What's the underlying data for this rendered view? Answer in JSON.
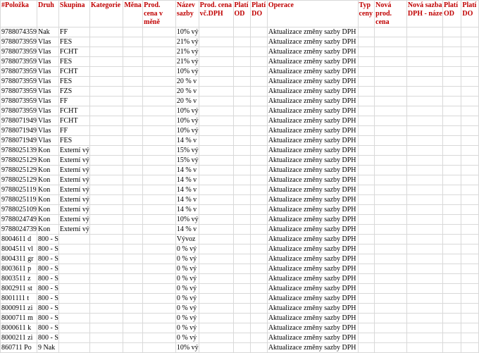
{
  "headers": [
    "#Položka",
    "Druh",
    "Skupina",
    "Kategorie",
    "Měna",
    "Prod. cena v měně",
    "Název sazby",
    "Prod. cena vč.DPH",
    "Platí OD",
    "Platí DO",
    "Operace",
    "Typ ceny",
    "Nová prod. cena",
    "Nová sazba DPH - náze",
    "Platí OD",
    "Platí DO"
  ],
  "rows": [
    [
      "9788074359",
      "Nak",
      "FF",
      "",
      "",
      "",
      "10% vý",
      "",
      "",
      "",
      "Aktualizace změny sazby DPH",
      "",
      "",
      "",
      "",
      ""
    ],
    [
      "9788073959",
      "Vlas",
      "FES",
      "",
      "",
      "",
      "21% vý",
      "",
      "",
      "",
      "Aktualizace změny sazby DPH",
      "",
      "",
      "",
      "",
      ""
    ],
    [
      "9788073959",
      "Vlas",
      "FCHT",
      "",
      "",
      "",
      "21% vý",
      "",
      "",
      "",
      "Aktualizace změny sazby DPH",
      "",
      "",
      "",
      "",
      ""
    ],
    [
      "9788073959",
      "Vlas",
      "FES",
      "",
      "",
      "",
      "21% vý",
      "",
      "",
      "",
      "Aktualizace změny sazby DPH",
      "",
      "",
      "",
      "",
      ""
    ],
    [
      "9788073959",
      "Vlas",
      "FCHT",
      "",
      "",
      "",
      "10% vý",
      "",
      "",
      "",
      "Aktualizace změny sazby DPH",
      "",
      "",
      "",
      "",
      ""
    ],
    [
      "9788073959",
      "Vlas",
      "FES",
      "",
      "",
      "",
      "20 % v",
      "",
      "",
      "",
      "Aktualizace změny sazby DPH",
      "",
      "",
      "",
      "",
      ""
    ],
    [
      "9788073959",
      "Vlas",
      "FZS",
      "",
      "",
      "",
      "20 % v",
      "",
      "",
      "",
      "Aktualizace změny sazby DPH",
      "",
      "",
      "",
      "",
      ""
    ],
    [
      "9788073959",
      "Vlas",
      "FF",
      "",
      "",
      "",
      "20 % v",
      "",
      "",
      "",
      "Aktualizace změny sazby DPH",
      "",
      "",
      "",
      "",
      ""
    ],
    [
      "9788073959",
      "Vlas",
      "FCHT",
      "",
      "",
      "",
      "10% vý",
      "",
      "",
      "",
      "Aktualizace změny sazby DPH",
      "",
      "",
      "",
      "",
      ""
    ],
    [
      "9788071949",
      "Vlas",
      "FCHT",
      "",
      "",
      "",
      "10% vý",
      "",
      "",
      "",
      "Aktualizace změny sazby DPH",
      "",
      "",
      "",
      "",
      ""
    ],
    [
      "9788071949",
      "Vlas",
      "FF",
      "",
      "",
      "",
      "10% vý",
      "",
      "",
      "",
      "Aktualizace změny sazby DPH",
      "",
      "",
      "",
      "",
      ""
    ],
    [
      "9788071949",
      "Vlas",
      "FES",
      "",
      "",
      "",
      "14 % v",
      "",
      "",
      "",
      "Aktualizace změny sazby DPH",
      "",
      "",
      "",
      "",
      ""
    ],
    [
      "9788025139",
      "Kon",
      "Externí vý",
      "",
      "",
      "",
      "15% vý",
      "",
      "",
      "",
      "Aktualizace změny sazby DPH",
      "",
      "",
      "",
      "",
      ""
    ],
    [
      "9788025129",
      "Kon",
      "Externí vý",
      "",
      "",
      "",
      "15% vý",
      "",
      "",
      "",
      "Aktualizace změny sazby DPH",
      "",
      "",
      "",
      "",
      ""
    ],
    [
      "9788025129",
      "Kon",
      "Externí vý",
      "",
      "",
      "",
      "14 % v",
      "",
      "",
      "",
      "Aktualizace změny sazby DPH",
      "",
      "",
      "",
      "",
      ""
    ],
    [
      "9788025129",
      "Kon",
      "Externí vý",
      "",
      "",
      "",
      "14 % v",
      "",
      "",
      "",
      "Aktualizace změny sazby DPH",
      "",
      "",
      "",
      "",
      ""
    ],
    [
      "9788025119",
      "Kon",
      "Externí vý",
      "",
      "",
      "",
      "14 % v",
      "",
      "",
      "",
      "Aktualizace změny sazby DPH",
      "",
      "",
      "",
      "",
      ""
    ],
    [
      "9788025119",
      "Kon",
      "Externí vý",
      "",
      "",
      "",
      "14 % v",
      "",
      "",
      "",
      "Aktualizace změny sazby DPH",
      "",
      "",
      "",
      "",
      ""
    ],
    [
      "9788025109",
      "Kon",
      "Externí vý",
      "",
      "",
      "",
      "14 % v",
      "",
      "",
      "",
      "Aktualizace změny sazby DPH",
      "",
      "",
      "",
      "",
      ""
    ],
    [
      "9788024749",
      "Kon",
      "Externí vý",
      "",
      "",
      "",
      "10% vý",
      "",
      "",
      "",
      "Aktualizace změny sazby DPH",
      "",
      "",
      "",
      "",
      ""
    ],
    [
      "9788024739",
      "Kon",
      "Externí vý",
      "",
      "",
      "",
      "14 % v",
      "",
      "",
      "",
      "Aktualizace změny sazby DPH",
      "",
      "",
      "",
      "",
      ""
    ],
    [
      "8004611 d",
      "800 - S",
      "",
      "",
      "",
      "",
      "Vývoz",
      "",
      "",
      "",
      "Aktualizace změny sazby DPH",
      "",
      "",
      "",
      "",
      ""
    ],
    [
      "8004511 vl",
      "800 - S",
      "",
      "",
      "",
      "",
      "0 % vý",
      "",
      "",
      "",
      "Aktualizace změny sazby DPH",
      "",
      "",
      "",
      "",
      ""
    ],
    [
      "8004311 gr",
      "800 - S",
      "",
      "",
      "",
      "",
      "0 % vý",
      "",
      "",
      "",
      "Aktualizace změny sazby DPH",
      "",
      "",
      "",
      "",
      ""
    ],
    [
      "8003611 p",
      "800 - S",
      "",
      "",
      "",
      "",
      "0 % vý",
      "",
      "",
      "",
      "Aktualizace změny sazby DPH",
      "",
      "",
      "",
      "",
      ""
    ],
    [
      "8003511 z",
      "800 - S",
      "",
      "",
      "",
      "",
      "0 % vý",
      "",
      "",
      "",
      "Aktualizace změny sazby DPH",
      "",
      "",
      "",
      "",
      ""
    ],
    [
      "8002911 st",
      "800 - S",
      "",
      "",
      "",
      "",
      "0 % vý",
      "",
      "",
      "",
      "Aktualizace změny sazby DPH",
      "",
      "",
      "",
      "",
      ""
    ],
    [
      "8001111 t",
      "800 - S",
      "",
      "",
      "",
      "",
      "0 % vý",
      "",
      "",
      "",
      "Aktualizace změny sazby DPH",
      "",
      "",
      "",
      "",
      ""
    ],
    [
      "8000911 zi",
      "800 - S",
      "",
      "",
      "",
      "",
      "0 % vý",
      "",
      "",
      "",
      "Aktualizace změny sazby DPH",
      "",
      "",
      "",
      "",
      ""
    ],
    [
      "8000711 m",
      "800 - S",
      "",
      "",
      "",
      "",
      "0 % vý",
      "",
      "",
      "",
      "Aktualizace změny sazby DPH",
      "",
      "",
      "",
      "",
      ""
    ],
    [
      "8000611 k",
      "800 - S",
      "",
      "",
      "",
      "",
      "0 % vý",
      "",
      "",
      "",
      "Aktualizace změny sazby DPH",
      "",
      "",
      "",
      "",
      ""
    ],
    [
      "8000211 zi",
      "800 - S",
      "",
      "",
      "",
      "",
      "0 % vý",
      "",
      "",
      "",
      "Aktualizace změny sazby DPH",
      "",
      "",
      "",
      "",
      ""
    ],
    [
      "860711 Po",
      "9 Nak",
      "",
      "",
      "",
      "",
      "10% vý",
      "",
      "",
      "",
      "Aktualizace změny sazby DPH",
      "",
      "",
      "",
      "",
      ""
    ]
  ]
}
